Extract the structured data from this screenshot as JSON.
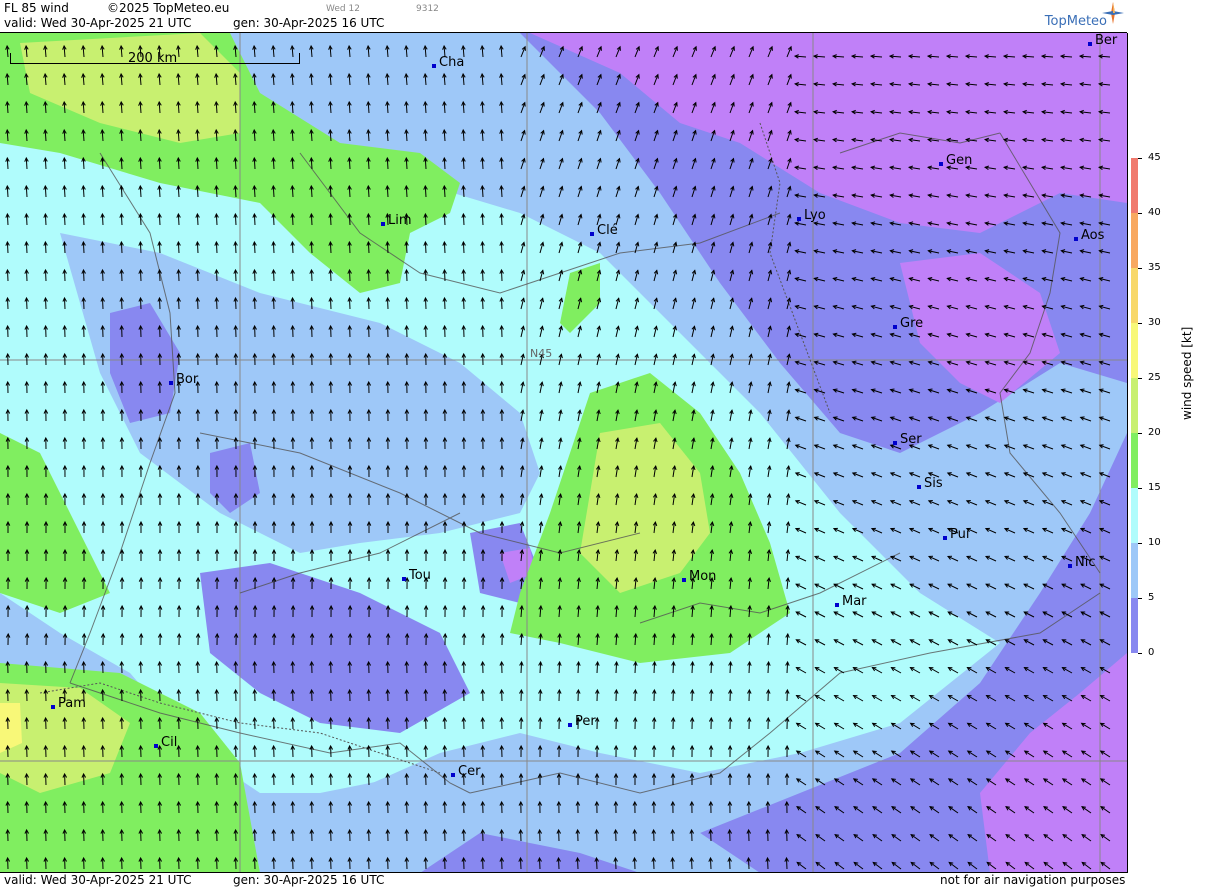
{
  "header": {
    "product": "FL 85 wind",
    "copyright": "©2025 TopMeteo.eu",
    "day_code": "Wed 12",
    "code": "9312",
    "valid": "valid:  Wed  30-Apr-2025  21 UTC",
    "gen": "gen: 30-Apr-2025 16 UTC",
    "brand": "TopMeteo"
  },
  "footer": {
    "valid": "valid:  Wed  30-Apr-2025  21 UTC",
    "gen": "gen: 30-Apr-2025 16 UTC",
    "disclaimer": "not for air navigation purposes"
  },
  "map": {
    "scale_label": "200 km",
    "grid_label": "N45",
    "cities": [
      {
        "name": "Cha"
      },
      {
        "name": "Ber"
      },
      {
        "name": "Lim"
      },
      {
        "name": "Clé"
      },
      {
        "name": "Lyo"
      },
      {
        "name": "Gen"
      },
      {
        "name": "Aos"
      },
      {
        "name": "Gre"
      },
      {
        "name": "Bor"
      },
      {
        "name": "Ser"
      },
      {
        "name": "Sis"
      },
      {
        "name": "Pui"
      },
      {
        "name": "Tou"
      },
      {
        "name": "Mon"
      },
      {
        "name": "Mar"
      },
      {
        "name": "Nic"
      },
      {
        "name": "Pam"
      },
      {
        "name": "Cil"
      },
      {
        "name": "Per"
      },
      {
        "name": "Cer"
      }
    ]
  },
  "legend": {
    "unit": "wind  speed  [kt]",
    "ticks": [
      "45",
      "40",
      "35",
      "30",
      "25",
      "20",
      "15",
      "10",
      "5",
      "0"
    ],
    "colors": [
      "#f07a6e",
      "#f8a860",
      "#f8d86a",
      "#f8f878",
      "#c8f070",
      "#80ee60",
      "#b0fcfc",
      "#9ec8f8",
      "#8888f0",
      "#c080f8"
    ]
  }
}
